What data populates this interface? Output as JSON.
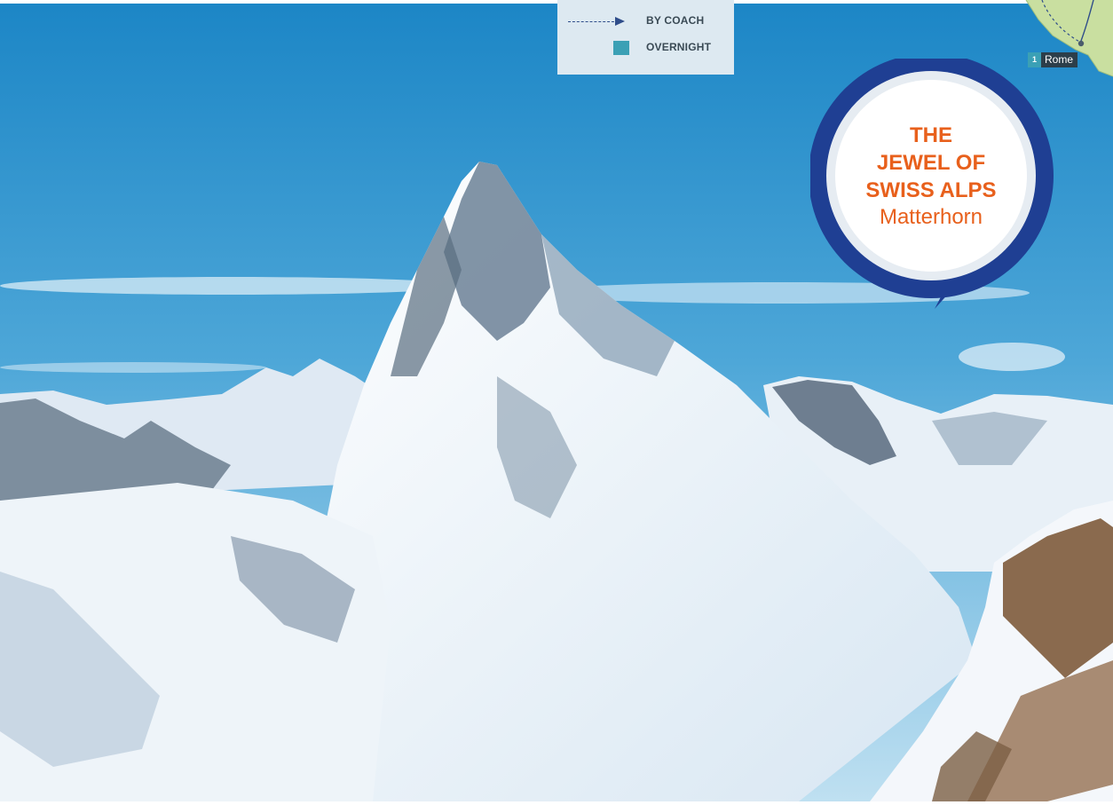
{
  "legend": {
    "by_coach": "BY COACH",
    "overnight": "OVERNIGHT"
  },
  "map": {
    "stop_number": "1",
    "stop_name": "Rome"
  },
  "callout": {
    "line1": "THE",
    "line2": "JEWEL OF",
    "line3": "SWISS ALPS",
    "subtitle": "Matterhorn"
  },
  "colors": {
    "accent_orange": "#e8601c",
    "bubble_ring": "#1f3f93",
    "legend_bg": "#dde9f1",
    "teal": "#3ba0b5",
    "map_green": "#c9dfa0"
  },
  "icons": {
    "coach": "dashed-arrow-icon",
    "overnight": "teal-square-icon",
    "stop": "map-pin-icon"
  }
}
